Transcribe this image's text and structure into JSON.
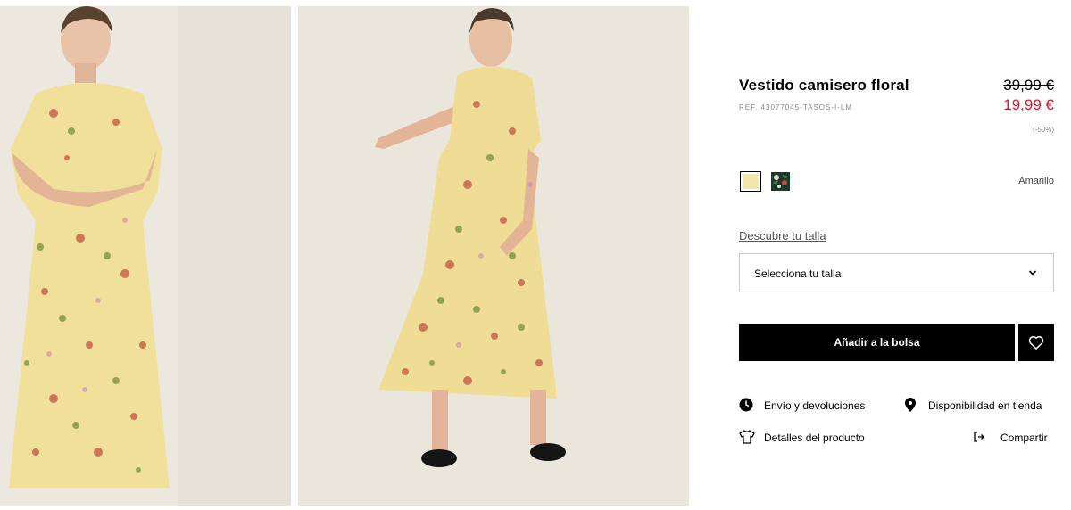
{
  "product": {
    "title": "Vestido camisero floral",
    "ref": "REF. 43077045-TASOS-I-LM",
    "price_old": "39,99 €",
    "price_new": "19,99 €",
    "discount": "(-50%)",
    "price_new_color": "#e0162b"
  },
  "colors": {
    "selected_name": "Amarillo",
    "swatches": [
      {
        "icon": "yellow-floral-swatch",
        "color": "#f2e6a8",
        "selected": true
      },
      {
        "icon": "dark-floral-swatch",
        "color": "#1a3a2a",
        "selected": false
      }
    ]
  },
  "size": {
    "guide_label": "Descubre tu talla",
    "select_label": "Selecciona tu talla"
  },
  "actions": {
    "add_to_bag": "Añadir a la bolsa",
    "favorite_icon": "heart-icon"
  },
  "links": {
    "shipping": "Envío y devoluciones",
    "availability": "Disponibilidad en tienda",
    "details": "Detalles del producto",
    "share": "Compartir"
  }
}
